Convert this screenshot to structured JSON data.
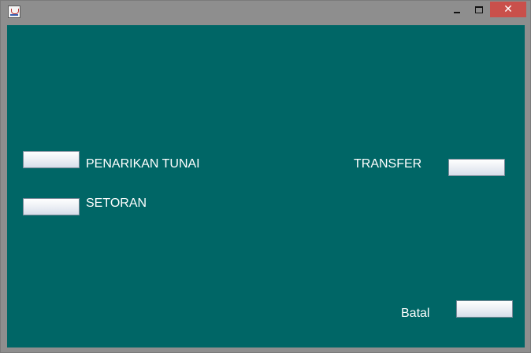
{
  "window": {
    "close_glyph": "✕"
  },
  "menu": {
    "penarikan_label": "PENARIKAN TUNAI",
    "setoran_label": "SETORAN",
    "transfer_label": "TRANSFER",
    "batal_label": "Batal"
  },
  "colors": {
    "background": "#006666",
    "label_text": "#ffffff",
    "close_button": "#c9504b"
  }
}
